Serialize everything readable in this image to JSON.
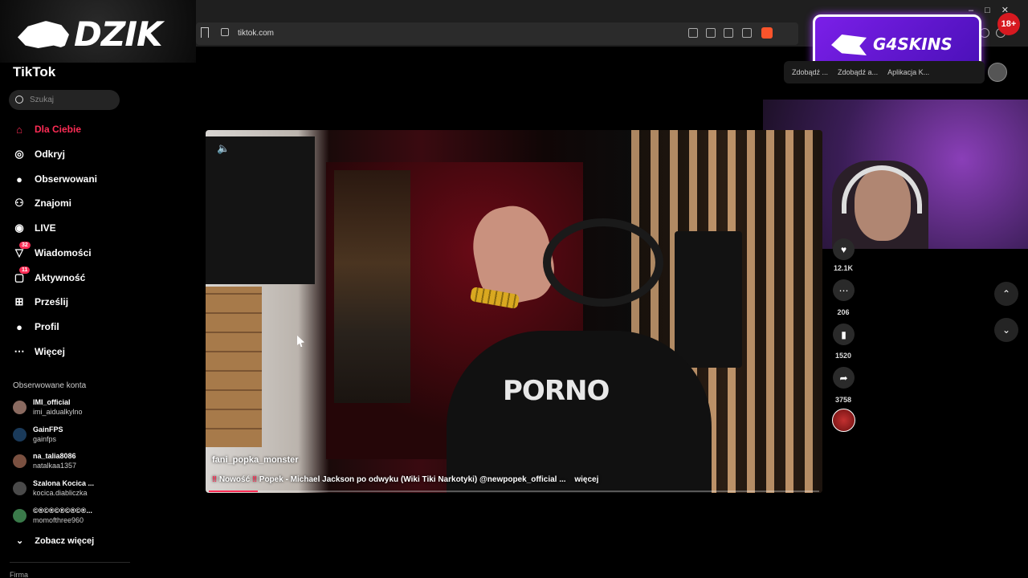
{
  "browser": {
    "url": "tiktok.com",
    "window_controls": "–□✕"
  },
  "overlay": {
    "dzik_logo": "DZIK",
    "sponsor": "G4SKINS",
    "age_badge": "18+"
  },
  "header_pills": [
    "Zdobądź ...",
    "Zdobądź a...",
    "Aplikacja K..."
  ],
  "sidebar": {
    "logo": "TikTok",
    "search_placeholder": "Szukaj",
    "nav": [
      {
        "label": "Dla Ciebie",
        "icon": "home-icon",
        "active": true
      },
      {
        "label": "Odkryj",
        "icon": "compass-icon"
      },
      {
        "label": "Obserwowani",
        "icon": "avatar-icon"
      },
      {
        "label": "Znajomi",
        "icon": "friends-icon"
      },
      {
        "label": "LIVE",
        "icon": "live-icon"
      },
      {
        "label": "Wiadomości",
        "icon": "inbox-icon",
        "badge": "32"
      },
      {
        "label": "Aktywność",
        "icon": "activity-icon",
        "badge": "11"
      },
      {
        "label": "Prześlij",
        "icon": "upload-icon"
      },
      {
        "label": "Profil",
        "icon": "profile-icon"
      },
      {
        "label": "Więcej",
        "icon": "more-icon"
      }
    ],
    "following_title": "Obserwowane konta",
    "following": [
      {
        "name": "IMI_official",
        "handle": "imi_aidualkylno"
      },
      {
        "name": "GainFPS",
        "handle": "gainfps"
      },
      {
        "name": "na_talia8086",
        "handle": "natalkaa1357"
      },
      {
        "name": "Szalona Kocica ...",
        "handle": "kocica.diabliczka"
      },
      {
        "name": "©®©®©®©®©®...",
        "handle": "momofthree960"
      }
    ],
    "see_more": "Zobacz więcej",
    "footer_section": "Firma"
  },
  "video": {
    "author": "fani_popka_monster",
    "desc_prefix": "‼",
    "desc_new": "Nowość",
    "desc_mid": "‼",
    "desc_text": "Popek - Michael Jackson po odwyku (Wiki Tiki Narkotyki) @newpopek_official ...",
    "more": "więcej",
    "shirt_text": "PORNO",
    "progress": 0.08
  },
  "actions": {
    "likes": "12.1K",
    "comments": "206",
    "saves": "1520",
    "shares": "3758"
  }
}
